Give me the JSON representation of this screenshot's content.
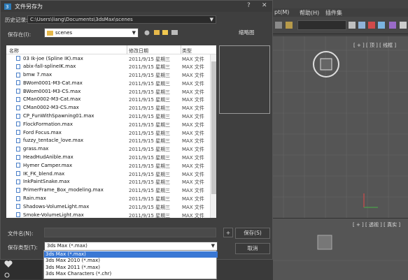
{
  "dialog": {
    "title": "文件另存为",
    "history_label": "历史记录:",
    "history_path": "C:\\Users\\liang\\Documents\\3dsMax\\scenes",
    "save_in_label": "保存在(I):",
    "save_in_value": "scenes",
    "thumbnail_label": "缩略图",
    "columns": {
      "name": "名称",
      "date": "修改日期",
      "type": "类型"
    },
    "files": [
      {
        "name": "03 Ik-joe (Spline IK).max",
        "date": "2011/9/15 星期三",
        "type": "MAX 文件"
      },
      {
        "name": "abix-fall-splineIK.max",
        "date": "2011/9/15 星期三",
        "type": "MAX 文件"
      },
      {
        "name": "bmw 7.max",
        "date": "2011/9/15 星期三",
        "type": "MAX 文件"
      },
      {
        "name": "BWom0001-M3-Cat.max",
        "date": "2011/9/15 星期三",
        "type": "MAX 文件"
      },
      {
        "name": "BWom0001-M3-CS.max",
        "date": "2011/9/15 星期三",
        "type": "MAX 文件"
      },
      {
        "name": "CMan0002-M3-Cat.max",
        "date": "2011/9/15 星期三",
        "type": "MAX 文件"
      },
      {
        "name": "CMan0002-M3-CS.max",
        "date": "2011/9/15 星期三",
        "type": "MAX 文件"
      },
      {
        "name": "CP_FunWithSpawning01.max",
        "date": "2011/9/15 星期三",
        "type": "MAX 文件"
      },
      {
        "name": "FlockFormation.max",
        "date": "2011/9/15 星期三",
        "type": "MAX 文件"
      },
      {
        "name": "Ford Focus.max",
        "date": "2011/9/15 星期三",
        "type": "MAX 文件"
      },
      {
        "name": "fuzzy_tentacle_love.max",
        "date": "2011/9/15 星期三",
        "type": "MAX 文件"
      },
      {
        "name": "grass.max",
        "date": "2011/9/15 星期三",
        "type": "MAX 文件"
      },
      {
        "name": "HeadHudAnible.max",
        "date": "2011/9/15 星期三",
        "type": "MAX 文件"
      },
      {
        "name": "Hymer Camper.max",
        "date": "2011/9/15 星期三",
        "type": "MAX 文件"
      },
      {
        "name": "IK_FK_blend.max",
        "date": "2011/9/15 星期三",
        "type": "MAX 文件"
      },
      {
        "name": "InkPaintSnake.max",
        "date": "2011/9/15 星期三",
        "type": "MAX 文件"
      },
      {
        "name": "PrimerFrame_Box_modeling.max",
        "date": "2011/9/15 星期三",
        "type": "MAX 文件"
      },
      {
        "name": "Rain.max",
        "date": "2011/9/15 星期三",
        "type": "MAX 文件"
      },
      {
        "name": "Shadows-VolumeLight.max",
        "date": "2011/9/15 星期三",
        "type": "MAX 文件"
      },
      {
        "name": "Smoke-VolumeLight.max",
        "date": "2011/9/15 星期三",
        "type": "MAX 文件"
      }
    ],
    "filename_label": "文件名(N):",
    "filename_value": "",
    "filetype_label": "保存类型(T):",
    "filetype_value": "3ds Max (*.max)",
    "plus_label": "+",
    "save_button": "保存(S)",
    "cancel_button": "取消",
    "filetype_options": [
      "3ds Max (*.max)",
      "3ds Max 2010 (*.max)",
      "3ds Max 2011 (*.max)",
      "3ds Max Characters (*.chr)"
    ],
    "selected_option_index": 0
  },
  "background": {
    "menus": [
      "pt(M)",
      "帮助(H)",
      "插件集"
    ],
    "viewport_top_label": "[ + ] [ 顶 ] [ 线框 ]",
    "viewport_bottom_label": "[ + ] [ 透视 ] [ 真实 ]",
    "accent_color": "#3a78d4"
  }
}
